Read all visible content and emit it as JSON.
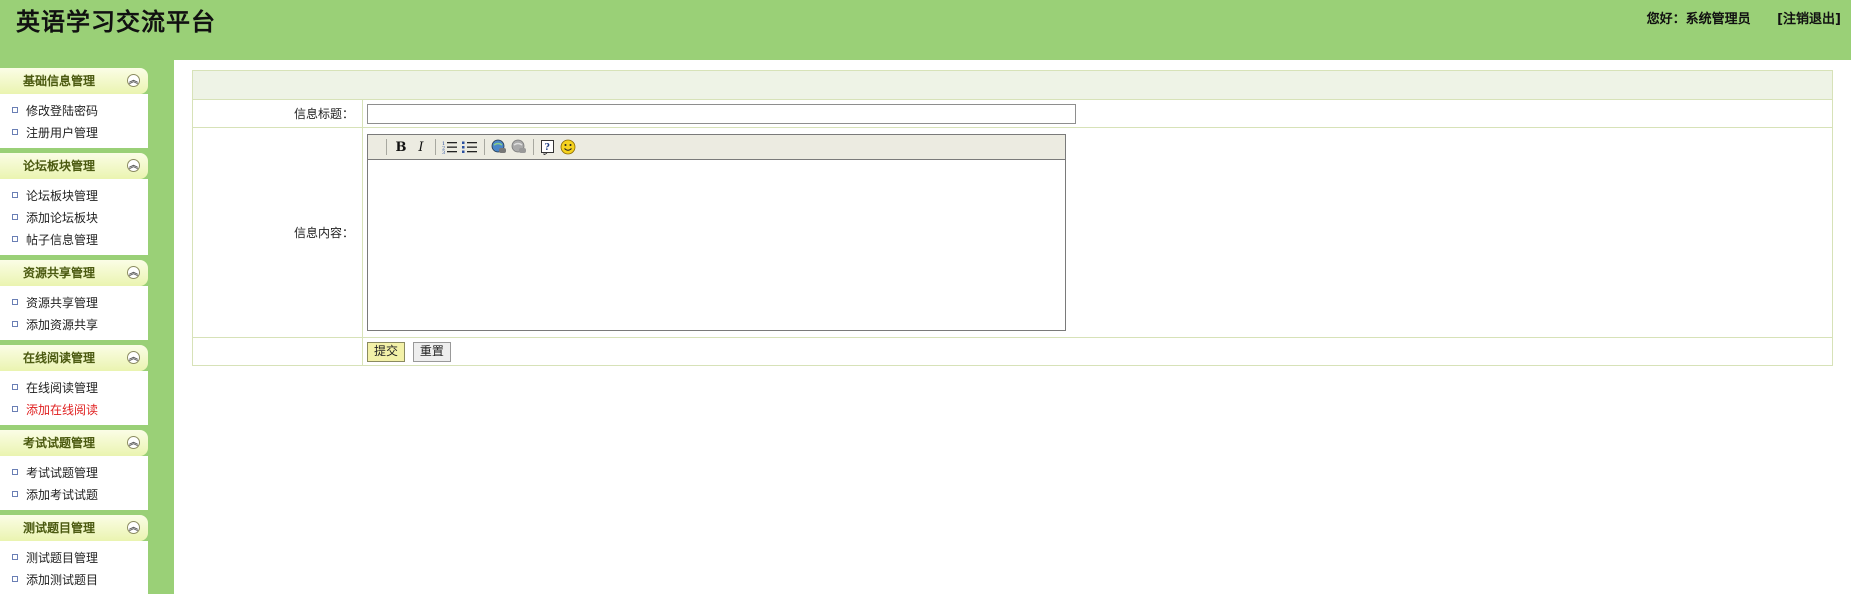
{
  "header": {
    "title": "英语学习交流平台",
    "greeting": "您好：系统管理员",
    "logout": "[注销退出]"
  },
  "sidebar": {
    "groups": [
      {
        "title": "基础信息管理",
        "items": [
          "修改登陆密码",
          "注册用户管理"
        ]
      },
      {
        "title": "论坛板块管理",
        "items": [
          "论坛板块管理",
          "添加论坛板块",
          "帖子信息管理"
        ]
      },
      {
        "title": "资源共享管理",
        "items": [
          "资源共享管理",
          "添加资源共享"
        ]
      },
      {
        "title": "在线阅读管理",
        "items": [
          "在线阅读管理",
          "添加在线阅读"
        ]
      },
      {
        "title": "考试试题管理",
        "items": [
          "考试试题管理",
          "添加考试试题"
        ]
      },
      {
        "title": "测试题目管理",
        "items": [
          "测试题目管理",
          "添加测试题目"
        ]
      }
    ],
    "active_item": "添加在线阅读"
  },
  "form": {
    "title_label": "信息标题：",
    "title_value": "",
    "content_label": "信息内容：",
    "submit_label": "提交",
    "reset_label": "重置"
  },
  "editor": {
    "bold": "B",
    "italic": "I",
    "tools": [
      "bold-icon",
      "italic-icon",
      "ordered-list-icon",
      "unordered-list-icon",
      "link-icon",
      "unlink-icon",
      "help-icon",
      "smiley-icon"
    ]
  },
  "colors": {
    "header_bg": "#9ad077",
    "active_item": "#e02020"
  }
}
